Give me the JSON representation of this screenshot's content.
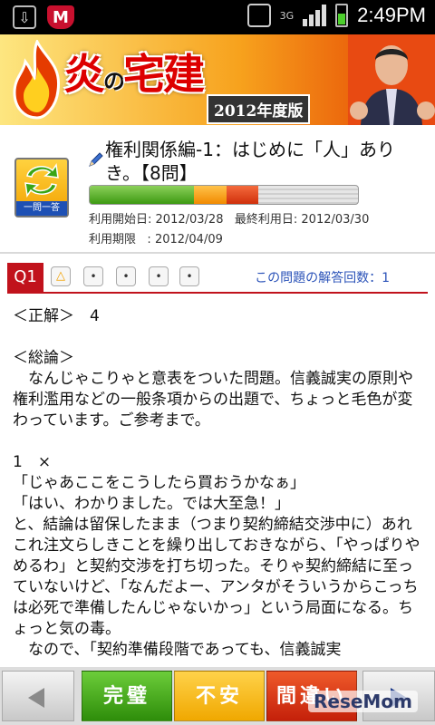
{
  "status_bar": {
    "time": "2:49PM",
    "network": "3G",
    "icons": [
      "download-icon",
      "mcafee-icon",
      "vibrate-icon",
      "signal-icon",
      "battery-icon"
    ]
  },
  "banner": {
    "title_part1": "炎",
    "title_part2": "の",
    "title_part3": "宅建",
    "edition": "2012年度版"
  },
  "course": {
    "icon_label": "一問一答",
    "title": "権利関係編-1：はじめに「人」ありき。【8問】",
    "progress_segments": [
      {
        "status": "complete",
        "fraction": 0.39
      },
      {
        "status": "uneasy",
        "fraction": 0.12
      },
      {
        "status": "wrong",
        "fraction": 0.12
      },
      {
        "status": "unanswered",
        "fraction": 0.37
      }
    ],
    "start_date_label": "利用開始日:",
    "start_date": "2012/03/28",
    "last_date_label": "最終利用日:",
    "last_date": "2012/03/30",
    "expiry_label": "利用期限",
    "expiry_date": "2012/04/09"
  },
  "question": {
    "number_label": "Q1",
    "warn_icon": "warning-triangle-icon",
    "marks": [
      "•",
      "•",
      "•",
      "•"
    ],
    "answer_count_text": "この問題の解答回数：1"
  },
  "content": {
    "correct_label": "＜正解＞",
    "correct_value": "4",
    "summary_label": "＜総論＞",
    "summary_text": "　なんじゃこりゃと意表をついた問題。信義誠実の原則や権利濫用などの一般条項からの出題で、ちょっと毛色が変わっています。ご参考まで。",
    "item1_label": "1　×",
    "item1_lines": [
      "「じゃあここをこうしたら買おうかなぁ」",
      "「はい、わかりました。では大至急！」",
      "と、結論は留保したまま（つまり契約締結交渉中に）あれこれ注文らしきことを繰り出しておきながら、「やっぱりやめるわ」と契約交渉を打ち切った。そりゃ契約締結に至っていないけど、「なんだよー、アンタがそういうからこっちは必死で準備したんじゃないかっ」という局面になる。ちょっと気の毒。",
      "　なので、「契約準備段階であっても、信義誠実"
    ]
  },
  "bottom_nav": {
    "prev_icon": "arrow-left-icon",
    "complete_label": "完璧",
    "uneasy_label": "不安",
    "wrong_label": "間違い",
    "next_icon": "arrow-right-icon",
    "watermark": "ReseMom"
  },
  "colors": {
    "accent_red": "#c1121c",
    "link_blue": "#2a52b8",
    "complete_green": "#3d9a12",
    "uneasy_orange": "#f0a800",
    "wrong_red": "#c4200a"
  }
}
